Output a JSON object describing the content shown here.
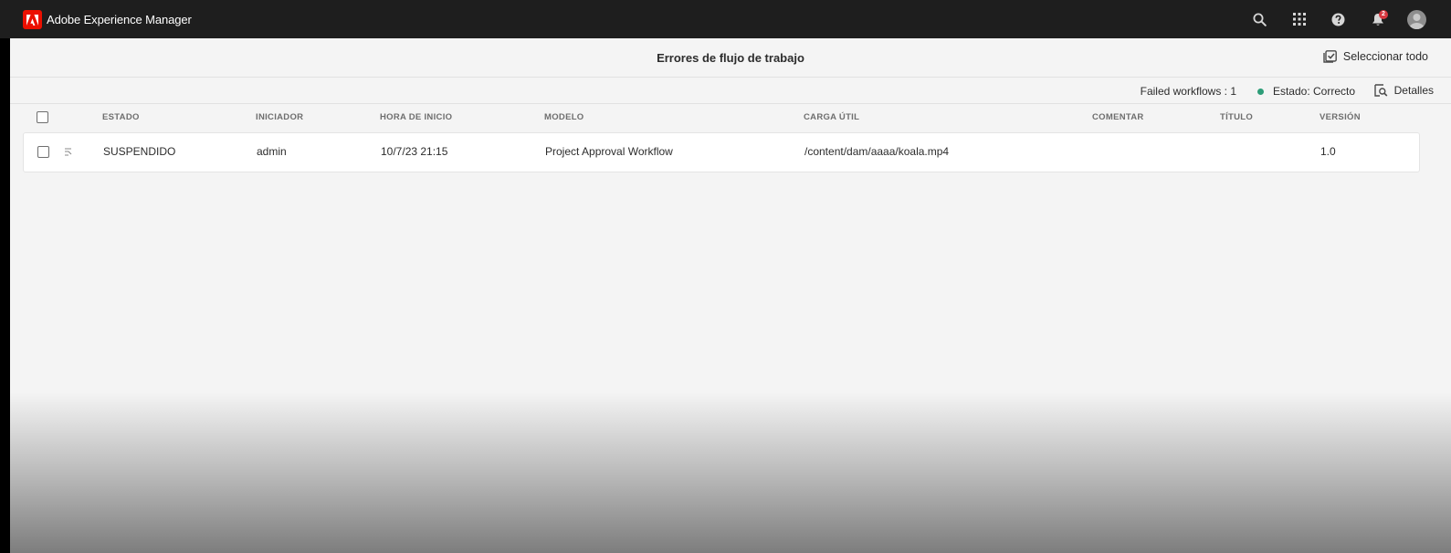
{
  "app": {
    "name": "Adobe Experience Manager"
  },
  "shell": {
    "icons": [
      "search-icon",
      "apps-grid-icon",
      "help-icon",
      "notifications-bell-icon",
      "user-avatar"
    ],
    "notification_count": "2"
  },
  "actionbar": {
    "title": "Errores de flujo de trabajo",
    "select_all_label": "Seleccionar todo"
  },
  "statusbar": {
    "failed_workflows": "Failed workflows : 1",
    "status": "Estado: Correcto",
    "status_color": "#2d9d78",
    "details_label": "Detalles"
  },
  "table": {
    "columns": [
      "ESTADO",
      "INICIADOR",
      "HORA DE INICIO",
      "MODELO",
      "CARGA ÚTIL",
      "COMENTAR",
      "TÍTULO",
      "VERSIÓN"
    ],
    "rows": [
      {
        "estado": "SUSPENDIDO",
        "iniciador": "admin",
        "hora_inicio": "10/7/23 21:15",
        "modelo": "Project Approval Workflow",
        "carga_util": "/content/dam/aaaa/koala.mp4",
        "comentar": "",
        "titulo": "",
        "version": "1.0"
      }
    ]
  },
  "colors": {
    "brand": "#eb1000",
    "shell_bg": "#1e1e1e",
    "page_bg": "#f4f4f4"
  }
}
